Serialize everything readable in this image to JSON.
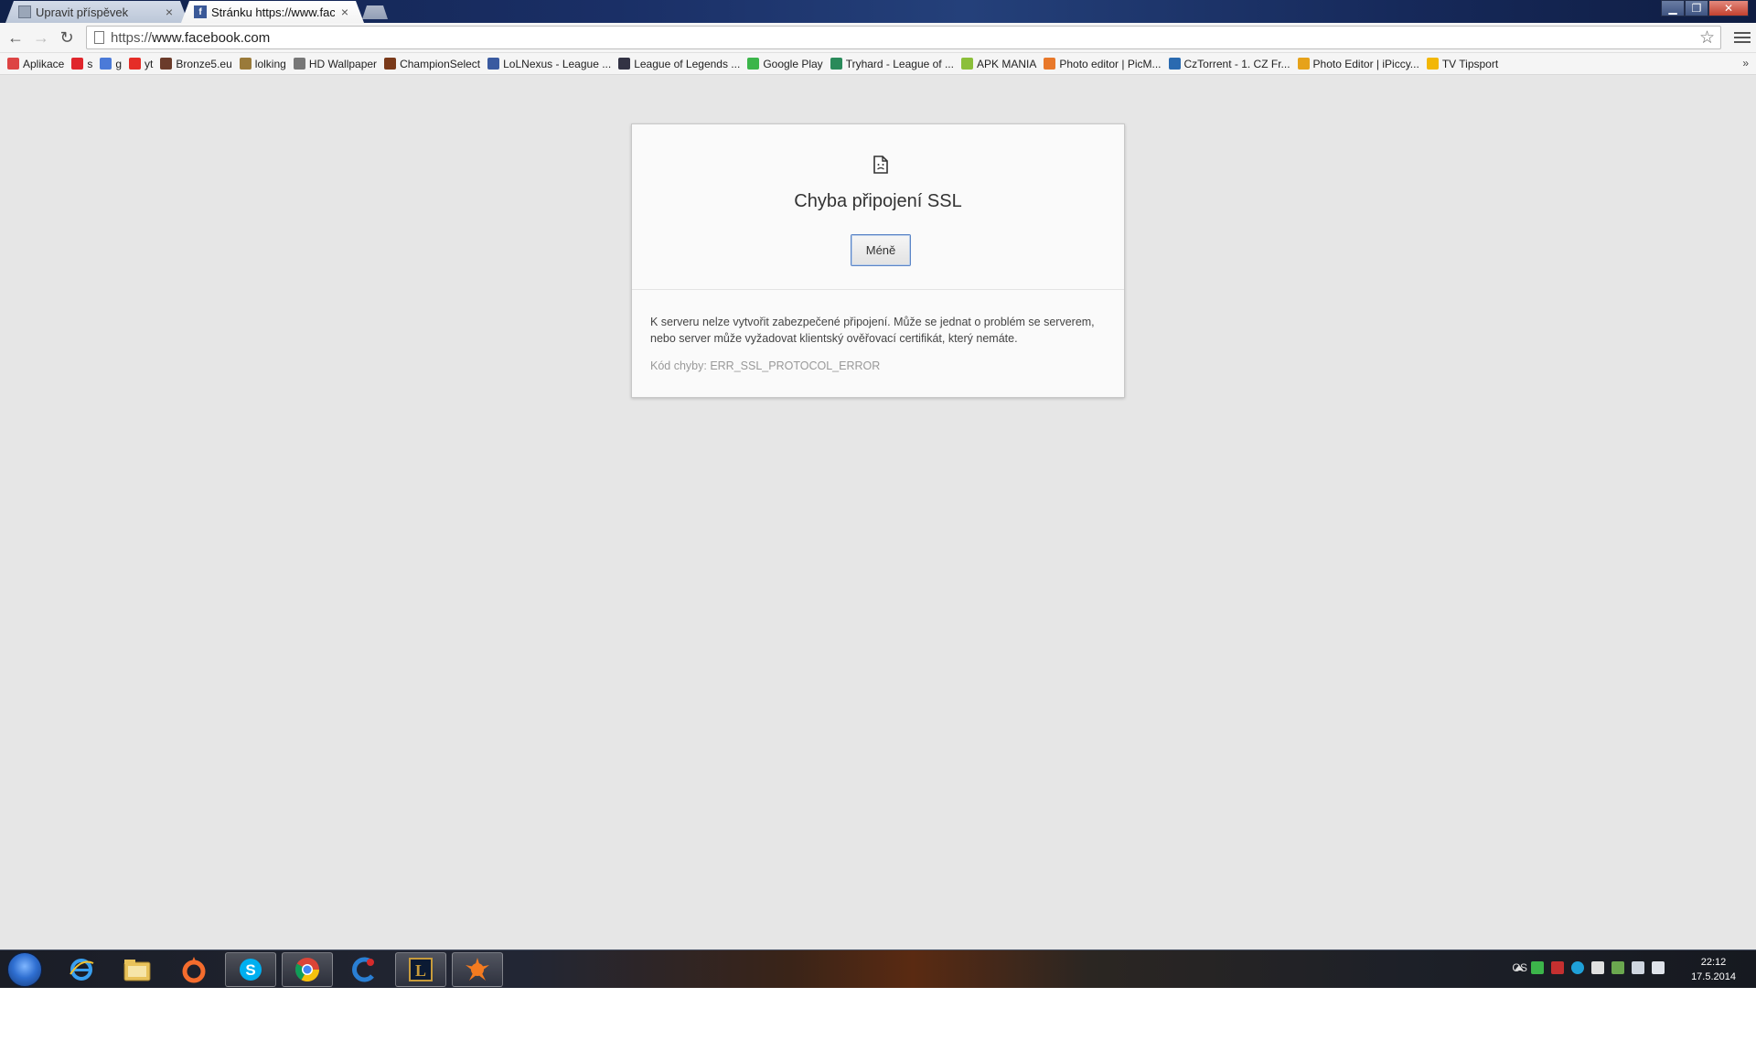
{
  "tabs": [
    {
      "title": "Upravit příspěvek",
      "favicon": "document-icon",
      "active": false
    },
    {
      "title": "Stránku https://www.face",
      "favicon": "facebook-icon",
      "active": true
    }
  ],
  "toolbar": {
    "url_scheme": "https://",
    "url_host": "www.facebook.com"
  },
  "bookmarks": [
    {
      "label": "Aplikace",
      "icon": "apps-grid-icon",
      "color": "#d44"
    },
    {
      "label": "s",
      "icon": "s-logo-icon",
      "color": "#e0262c"
    },
    {
      "label": "g",
      "icon": "google-plus-icon",
      "color": "#4b7ad8"
    },
    {
      "label": "yt",
      "icon": "youtube-icon",
      "color": "#e52d27"
    },
    {
      "label": "Bronze5.eu",
      "icon": "bronze5-icon",
      "color": "#6b3b2a"
    },
    {
      "label": "lolking",
      "icon": "lolking-icon",
      "color": "#9a7a3a"
    },
    {
      "label": "HD Wallpaper",
      "icon": "wallpaper-icon",
      "color": "#777"
    },
    {
      "label": "ChampionSelect",
      "icon": "championselect-icon",
      "color": "#7a3a1a"
    },
    {
      "label": "LoLNexus - League ...",
      "icon": "lolnexus-icon",
      "color": "#3a5aa0"
    },
    {
      "label": "League of Legends ...",
      "icon": "wiki-icon",
      "color": "#334"
    },
    {
      "label": "Google Play",
      "icon": "google-play-icon",
      "color": "#3bb54a"
    },
    {
      "label": "Tryhard - League of ...",
      "icon": "tryhard-icon",
      "color": "#2a8a5a"
    },
    {
      "label": "APK MANIA",
      "icon": "android-icon",
      "color": "#8bbf3a"
    },
    {
      "label": "Photo editor | PicM...",
      "icon": "picmonkey-icon",
      "color": "#e8782a"
    },
    {
      "label": "CzTorrent - 1. CZ Fr...",
      "icon": "cztorrent-icon",
      "color": "#2a6ab0"
    },
    {
      "label": "Photo Editor | iPiccy...",
      "icon": "ipiccy-icon",
      "color": "#e6a21a"
    },
    {
      "label": "TV Tipsport",
      "icon": "tipsport-icon",
      "color": "#f2b705"
    }
  ],
  "bookmarks_more": "»",
  "error": {
    "title": "Chyba připojení SSL",
    "button_label": "Méně",
    "details": "K serveru nelze vytvořit zabezpečené připojení. Může se jednat o problém se serverem, nebo server může vyžadovat klientský ověřovací certifikát, který nemáte.",
    "code_label": "Kód chyby: ERR_SSL_PROTOCOL_ERROR"
  },
  "taskbar": {
    "apps": [
      {
        "name": "internet-explorer-icon",
        "open": false
      },
      {
        "name": "file-explorer-icon",
        "open": false
      },
      {
        "name": "origin-icon",
        "open": false
      },
      {
        "name": "skype-icon",
        "open": true
      },
      {
        "name": "chrome-icon",
        "open": true
      },
      {
        "name": "ccleaner-icon",
        "open": false
      },
      {
        "name": "league-of-legends-icon",
        "open": true
      },
      {
        "name": "avast-icon",
        "open": true
      }
    ],
    "language": "CS",
    "time": "22:12",
    "date": "17.5.2014"
  }
}
